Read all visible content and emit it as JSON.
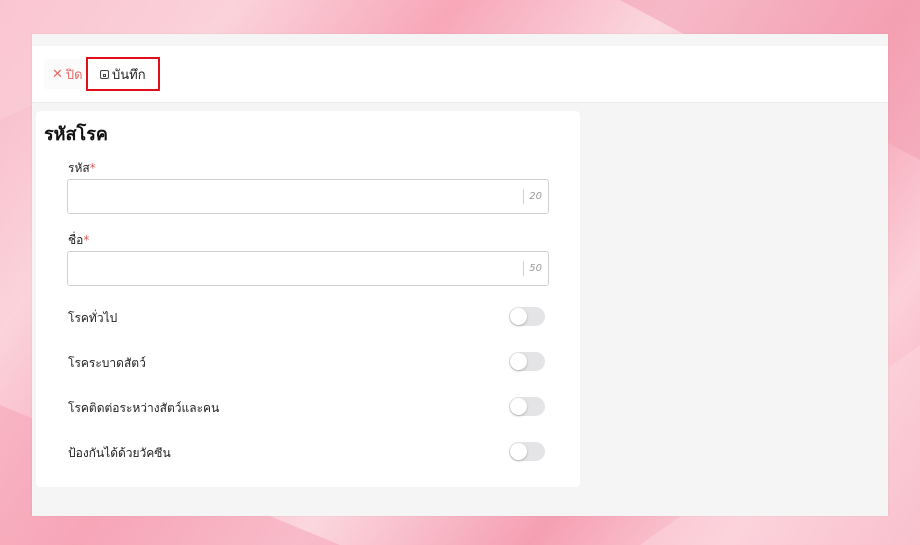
{
  "toolbar": {
    "close_label": "ปิด",
    "save_label": "บันทึก"
  },
  "form": {
    "title": "รหัสโรค",
    "fields": [
      {
        "label": "รหัส",
        "required_mark": "*",
        "value": "",
        "counter": "20"
      },
      {
        "label": "ชื่อ",
        "required_mark": "*",
        "value": "",
        "counter": "50"
      }
    ],
    "toggles": [
      {
        "label": "โรคทั่วไป",
        "on": false
      },
      {
        "label": "โรคระบาดสัตว์",
        "on": false
      },
      {
        "label": "โรคติดต่อระหว่างสัตว์และคน",
        "on": false
      },
      {
        "label": "ป้องกันได้ด้วยวัคซีน",
        "on": false
      }
    ]
  },
  "colors": {
    "close_text": "#e56a6a",
    "highlight_border": "#e10f1a",
    "required_mark": "#e35d5d"
  },
  "icons": {
    "close": "close-icon",
    "save": "save-icon"
  }
}
